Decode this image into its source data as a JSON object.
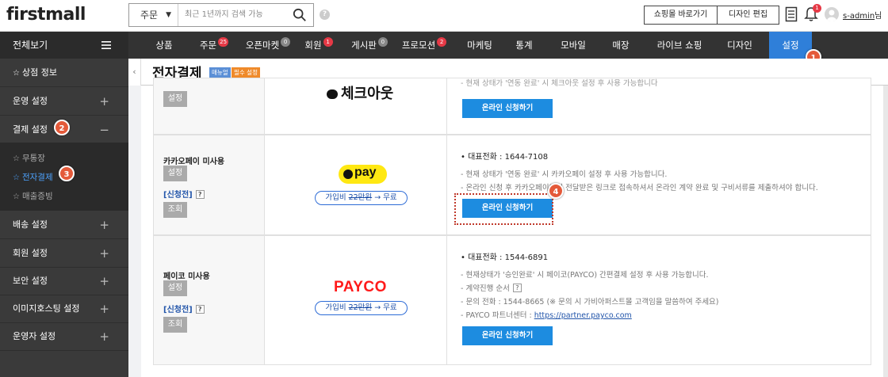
{
  "app": {
    "logo": "firstmall"
  },
  "search": {
    "category": "주문",
    "placeholder": "최근 1년까지 검색 가능"
  },
  "top_buttons": {
    "shop": "쇼핑몰 바로가기",
    "design": "디자인 편집"
  },
  "user": {
    "name": "s-admin",
    "suffix": "님",
    "notification_count": "1"
  },
  "all_view": "전체보기",
  "nav": [
    {
      "label": "상품",
      "badge": ""
    },
    {
      "label": "주문",
      "badge": "25"
    },
    {
      "label": "오픈마켓",
      "badge": "0"
    },
    {
      "label": "회원",
      "badge": "1"
    },
    {
      "label": "게시판",
      "badge": "0"
    },
    {
      "label": "프로모션",
      "badge": "2"
    },
    {
      "label": "마케팅",
      "badge": ""
    },
    {
      "label": "통계",
      "badge": ""
    },
    {
      "label": "모바일",
      "badge": ""
    },
    {
      "label": "매장",
      "badge": ""
    },
    {
      "label": "라이브 쇼핑",
      "badge": ""
    },
    {
      "label": "디자인",
      "badge": ""
    },
    {
      "label": "설정",
      "badge": ""
    }
  ],
  "sidebar": {
    "items": [
      {
        "label": "상점 정보"
      },
      {
        "label": "운영 설정"
      },
      {
        "label": "결제 설정"
      },
      {
        "label": "배송 설정"
      },
      {
        "label": "회원 설정"
      },
      {
        "label": "보안 설정"
      },
      {
        "label": "이미지호스팅 설정"
      },
      {
        "label": "운영자 설정"
      }
    ],
    "sub_items": [
      {
        "label": "무통장"
      },
      {
        "label": "전자결제"
      },
      {
        "label": "매출증빙"
      }
    ]
  },
  "page": {
    "title": "전자결제",
    "tag_manual": "매뉴얼",
    "tag_required": "필수 설정"
  },
  "callouts": [
    "1",
    "2",
    "3",
    "4"
  ],
  "cards": {
    "checkout": {
      "setting_btn": "설정",
      "logo_text": "체크아웃",
      "partial_note": "- 현재 상태가 '연동 완료' 시 체크아웃 설정 후 사용 가능합니다",
      "apply_btn": "온라인 신청하기"
    },
    "kakao": {
      "name": "카카오페이 미사용",
      "setting_btn": "설정",
      "status_link": "[신청전]",
      "help": "?",
      "query_btn": "조회",
      "logo_text": "pay",
      "price_prefix": "가입비 ",
      "price_old": "22만원",
      "price_new": " → 무료",
      "phone": "대표전화 : 1644-7108",
      "notes": [
        "- 현재 상태가 '연동 완료' 시 카카오페이 설정 후 사용 가능합니다.",
        "- 온라인 신청 후 카카오페이에서 전달받은 링크로 접속하셔서 온라인 계약 완료 및 구비서류를 제출하셔야 합니다."
      ],
      "apply_btn": "온라인 신청하기"
    },
    "payco": {
      "name": "페이코 미사용",
      "setting_btn": "설정",
      "status_link": "[신청전]",
      "help": "?",
      "query_btn": "조회",
      "logo_text": "PAYCO",
      "price_prefix": "가입비 ",
      "price_old": "22만원",
      "price_new": " → 무료",
      "phone": "대표전화 : 1544-6891",
      "notes": [
        "- 현재상태가 '승인완료' 시 페이코(PAYCO) 간편결제 설정 후 사용 가능합니다.",
        "- 계약진행 순서",
        "- 문의 전화 : 1544-8665 (※ 문의 시 가비아퍼스트몰 고객임을 말씀하여 주세요)",
        "- PAYCO 파트너센터 : "
      ],
      "partner_link": "https://partner.payco.com",
      "apply_btn": "온라인 신청하기"
    }
  },
  "colors": {
    "nav_bg": "#333333",
    "active_blue": "#2f7fd9",
    "button_blue": "#1d8ce0",
    "callout": "#e45a3a",
    "kakao_yellow": "#ffe812",
    "payco_red": "#ff1a1a"
  }
}
